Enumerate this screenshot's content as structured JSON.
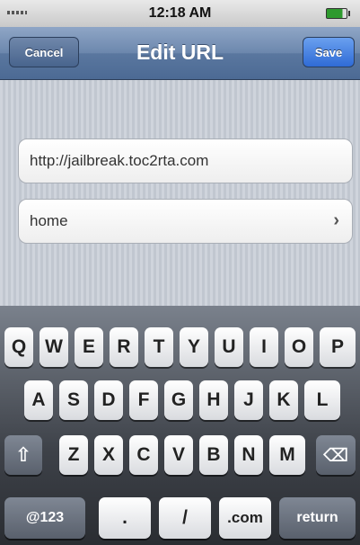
{
  "status_bar": {
    "time": "12:18 AM"
  },
  "nav": {
    "title": "Edit URL",
    "cancel_label": "Cancel",
    "save_label": "Save"
  },
  "fields": {
    "url_value": "http://jailbreak.toc2rta.com",
    "home_label": "home",
    "home_chevron": "›"
  },
  "keyboard": {
    "row1": [
      "Q",
      "W",
      "E",
      "R",
      "T",
      "Y",
      "U",
      "I",
      "O",
      "P"
    ],
    "row2": [
      "A",
      "S",
      "D",
      "F",
      "G",
      "H",
      "J",
      "K",
      "L"
    ],
    "row3": [
      "Z",
      "X",
      "C",
      "V",
      "B",
      "N",
      "M"
    ],
    "shift": "⇧",
    "backspace": "⌫",
    "mode_label": "@123",
    "dot": ".",
    "slash": "/",
    "dotcom": ".com",
    "return_label": "return"
  }
}
